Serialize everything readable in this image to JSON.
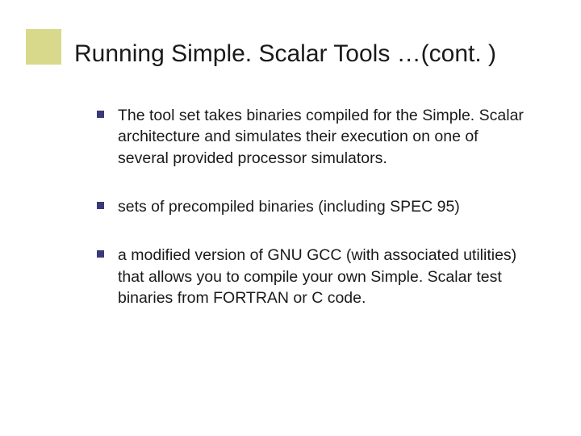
{
  "colors": {
    "accent_block": "#d9d98c",
    "bullet_square": "#3a3a7a",
    "text": "#1a1a1a"
  },
  "title": "Running Simple. Scalar Tools …(cont. )",
  "bullets": [
    "The tool set takes binaries compiled for the Simple. Scalar architecture and simulates their execution on one of several provided processor simulators.",
    "sets of precompiled binaries (including SPEC 95)",
    "a modified version of GNU GCC (with associated utilities) that allows you to compile your own Simple. Scalar test binaries from FORTRAN or C code."
  ]
}
